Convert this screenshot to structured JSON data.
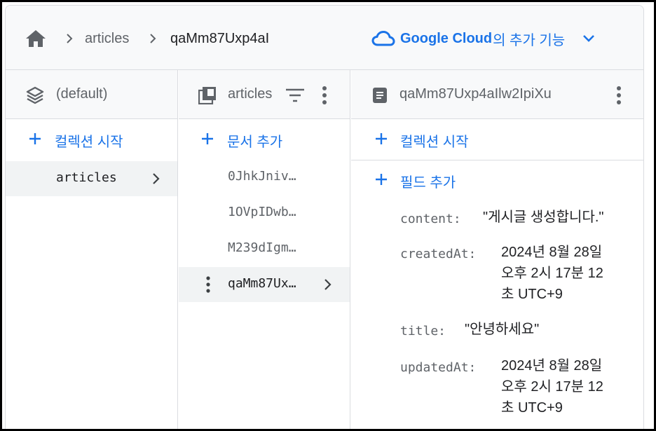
{
  "breadcrumb": {
    "home_icon": "home-icon",
    "items": [
      "articles",
      "qaMm87Uxp4aI"
    ]
  },
  "gcloud": {
    "brand": "Google Cloud",
    "suffix": "의 추가 기능",
    "icon": "cloud-icon",
    "accent": "#1a73e8"
  },
  "columns": {
    "root": {
      "title": "(default)",
      "add_label": "컬렉션 시작",
      "items": [
        {
          "label": "articles",
          "selected": true
        }
      ]
    },
    "collection": {
      "title": "articles",
      "add_label": "문서 추가",
      "items": [
        {
          "label": "0JhkJniv…",
          "selected": false
        },
        {
          "label": "1OVpIDwb…",
          "selected": false
        },
        {
          "label": "M239dIgm…",
          "selected": false
        },
        {
          "label": "qaMm87Ux…",
          "selected": true
        }
      ]
    },
    "document": {
      "title": "qaMm87Uxp4aIlw2IpiXu",
      "add_collection_label": "컬렉션 시작",
      "add_field_label": "필드 추가",
      "fields": [
        {
          "key": "content:",
          "value": "\"게시글 생성합니다.\""
        },
        {
          "key": "createdAt:",
          "value_lines": [
            "2024년 8월 28일",
            "오후 2시 17분 12",
            "초 UTC+9"
          ]
        },
        {
          "key": "title:",
          "value": "\"안녕하세요\""
        },
        {
          "key": "updatedAt:",
          "value_lines": [
            "2024년 8월 28일",
            "오후 2시 17분 12",
            "초 UTC+9"
          ]
        }
      ]
    }
  },
  "colors": {
    "link_blue": "#1a73e8",
    "header_bg": "#f8f9fa",
    "selected_bg": "#f1f3f4",
    "border": "#dadce0"
  }
}
